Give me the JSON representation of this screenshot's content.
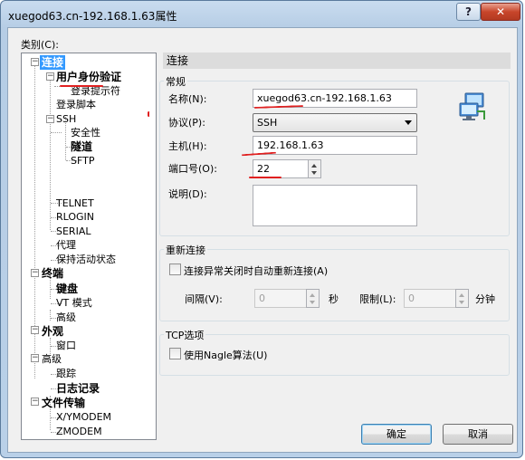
{
  "window": {
    "title": "xuegod63.cn-192.168.1.63属性",
    "help_glyph": "?",
    "close_glyph": "✕"
  },
  "category_label": "类别(C):",
  "tree": {
    "connection": "连接",
    "auth": "用户身份验证",
    "login_prompts": "登录提示符",
    "login_script": "登录脚本",
    "ssh": "SSH",
    "security": "安全性",
    "tunnel": "隧道",
    "sftp": "SFTP",
    "telnet": "TELNET",
    "rlogin": "RLOGIN",
    "serial": "SERIAL",
    "proxy": "代理",
    "keepalive": "保持活动状态",
    "terminal": "终端",
    "keyboard": "键盘",
    "vt_mode": "VT 模式",
    "terminal_advanced": "高级",
    "appearance": "外观",
    "window": "窗口",
    "advanced": "高级",
    "tracking": "跟踪",
    "logging": "日志记录",
    "file_transfer": "文件传输",
    "xymodem": "X/YMODEM",
    "zmodem": "ZMODEM"
  },
  "panel": {
    "header": "连接",
    "general": {
      "legend": "常规",
      "name_label": "名称(N):",
      "name_value": "xuegod63.cn-192.168.1.63",
      "protocol_label": "协议(P):",
      "protocol_value": "SSH",
      "host_label": "主机(H):",
      "host_value": "192.168.1.63",
      "port_label": "端口号(O):",
      "port_value": "22",
      "desc_label": "说明(D):",
      "desc_value": ""
    },
    "reconnect": {
      "legend": "重新连接",
      "auto_label": "连接异常关闭时自动重新连接(A)",
      "auto_checked": false,
      "interval_label": "间隔(V):",
      "interval_value": "0",
      "seconds_unit": "秒",
      "limit_label": "限制(L):",
      "limit_value": "0",
      "minutes_unit": "分钟"
    },
    "tcp": {
      "legend": "TCP选项",
      "nagle_label": "使用Nagle算法(U)",
      "nagle_checked": false
    }
  },
  "buttons": {
    "ok": "确定",
    "cancel": "取消"
  },
  "icons": {
    "session": "network-computer-icon"
  },
  "colors": {
    "selection": "#3399ff",
    "annotation": "#e02020",
    "title_bar": "#b9d0e8"
  }
}
